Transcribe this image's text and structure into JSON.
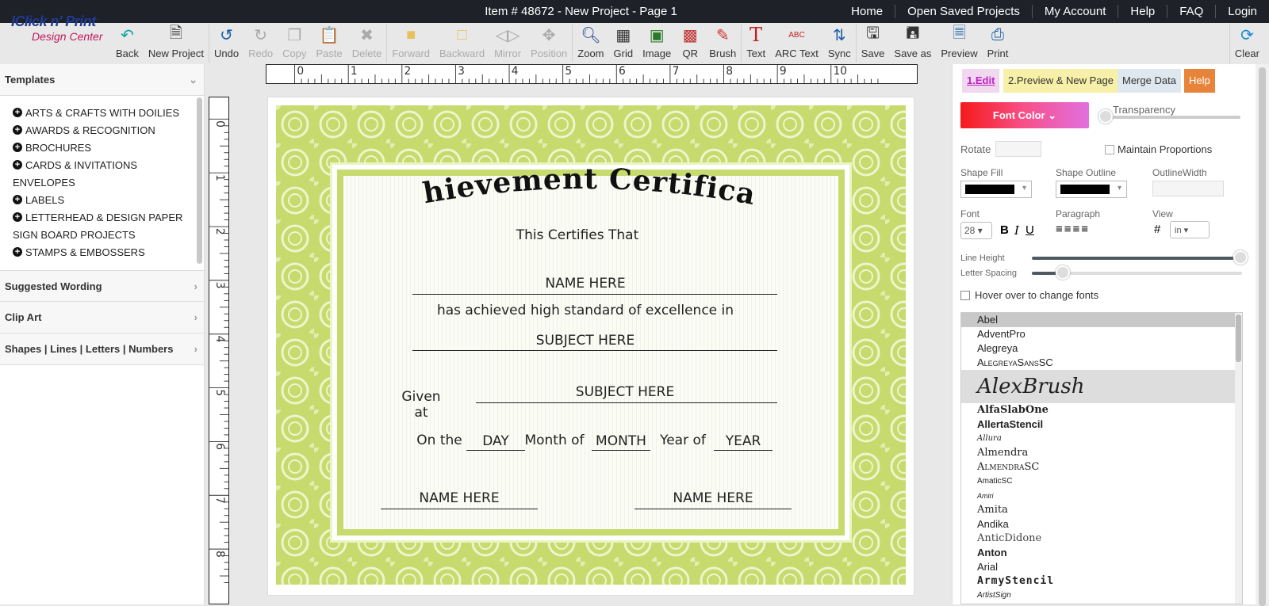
{
  "header": {
    "title": "Item # 48672 - New Project - Page 1",
    "nav": [
      "Home",
      "Open Saved Projects",
      "My Account",
      "Help",
      "FAQ",
      "Login"
    ]
  },
  "logo": {
    "line1": "IClick n' Print",
    "line2": "Design Center"
  },
  "toolbar": {
    "items": [
      {
        "label": "Back",
        "icon": "back-arrow-icon",
        "enabled": true
      },
      {
        "label": "New Project",
        "icon": "new-page-icon",
        "enabled": true
      },
      {
        "label": "Undo",
        "icon": "undo-icon",
        "enabled": true
      },
      {
        "label": "Redo",
        "icon": "redo-icon",
        "enabled": false
      },
      {
        "label": "Copy",
        "icon": "copy-icon",
        "enabled": false
      },
      {
        "label": "Paste",
        "icon": "paste-icon",
        "enabled": false
      },
      {
        "label": "Delete",
        "icon": "delete-icon",
        "enabled": false
      },
      {
        "label": "Forward",
        "icon": "forward-icon",
        "enabled": false
      },
      {
        "label": "Backward",
        "icon": "backward-icon",
        "enabled": false
      },
      {
        "label": "Mirror",
        "icon": "mirror-icon",
        "enabled": false
      },
      {
        "label": "Position",
        "icon": "position-icon",
        "enabled": false
      },
      {
        "label": "Zoom",
        "icon": "zoom-icon",
        "enabled": true
      },
      {
        "label": "Grid",
        "icon": "grid-icon",
        "enabled": true
      },
      {
        "label": "Image",
        "icon": "image-icon",
        "enabled": true
      },
      {
        "label": "QR",
        "icon": "qr-icon",
        "enabled": true
      },
      {
        "label": "Brush",
        "icon": "brush-icon",
        "enabled": true
      },
      {
        "label": "Text",
        "icon": "text-icon",
        "enabled": true
      },
      {
        "label": "ARC Text",
        "icon": "arc-text-icon",
        "enabled": true
      },
      {
        "label": "Sync",
        "icon": "sync-icon",
        "enabled": true
      },
      {
        "label": "Save",
        "icon": "save-icon",
        "enabled": true
      },
      {
        "label": "Save as",
        "icon": "save-as-icon",
        "enabled": true
      },
      {
        "label": "Preview",
        "icon": "preview-icon",
        "enabled": true
      },
      {
        "label": "Print",
        "icon": "print-icon",
        "enabled": true
      }
    ],
    "clear_label": "Clear"
  },
  "left": {
    "templates_label": "Templates",
    "templates": [
      {
        "label": "ARTS & CRAFTS WITH DOILIES",
        "expandable": true
      },
      {
        "label": "AWARDS & RECOGNITION",
        "expandable": true
      },
      {
        "label": "BROCHURES",
        "expandable": true
      },
      {
        "label": "CARDS & INVITATIONS",
        "expandable": true
      },
      {
        "label": "ENVELOPES",
        "expandable": false
      },
      {
        "label": "LABELS",
        "expandable": true
      },
      {
        "label": "LETTERHEAD & DESIGN PAPER",
        "expandable": true
      },
      {
        "label": "SIGN BOARD PROJECTS",
        "expandable": false
      },
      {
        "label": "STAMPS & EMBOSSERS",
        "expandable": true
      }
    ],
    "sections": [
      "Suggested Wording",
      "Clip Art",
      "Shapes | Lines | Letters | Numbers"
    ]
  },
  "ruler": {
    "h": [
      "0",
      "1",
      "2",
      "3",
      "4",
      "5",
      "6",
      "7",
      "8",
      "9",
      "10"
    ],
    "v": [
      "0",
      "1",
      "2",
      "3",
      "4",
      "5",
      "6",
      "7",
      "8"
    ]
  },
  "certificate": {
    "title": "Achievement Certificate",
    "certifies": "This Certifies That",
    "name": "NAME HERE",
    "achieved": "has achieved high standard of excellence in",
    "subject": "SUBJECT HERE",
    "given_at": "Given at",
    "given_subject": "SUBJECT HERE",
    "on_the": "On the",
    "day": "DAY",
    "month_of": "Month of",
    "month": "MONTH",
    "year_of": "Year of",
    "year": "YEAR",
    "sig1": "NAME HERE",
    "sig2": "NAME HERE",
    "colors": {
      "border": "#c6da6e"
    }
  },
  "right": {
    "tabs": [
      "1.Edit",
      "2.Preview & New Page",
      "Merge Data",
      "Help"
    ],
    "font_color": "Font Color",
    "transparency": "Transparency",
    "rotate": "Rotate",
    "maintain": "Maintain Proportions",
    "shape_fill": "Shape Fill",
    "shape_outline": "Shape Outline",
    "outline_width": "OutlineWidth",
    "font_label": "Font",
    "font_size": "28",
    "paragraph": "Paragraph",
    "view": "View",
    "view_unit": "in",
    "line_height": "Line Height",
    "letter_spacing": "Letter Spacing",
    "hover": "Hover over to change fonts",
    "fonts": [
      "Abel",
      "AdventPro",
      "Alegreya",
      "AlegreyaSansSC",
      "AlexBrush",
      "AlfaSlabOne",
      "AllertaStencil",
      "Allura",
      "Almendra",
      "AlmendraSC",
      "AmaticSC",
      "Amiri",
      "Amita",
      "Andika",
      "AnticDidone",
      "Anton",
      "Arial",
      "ArmyStencil",
      "ArtistSign"
    ]
  }
}
